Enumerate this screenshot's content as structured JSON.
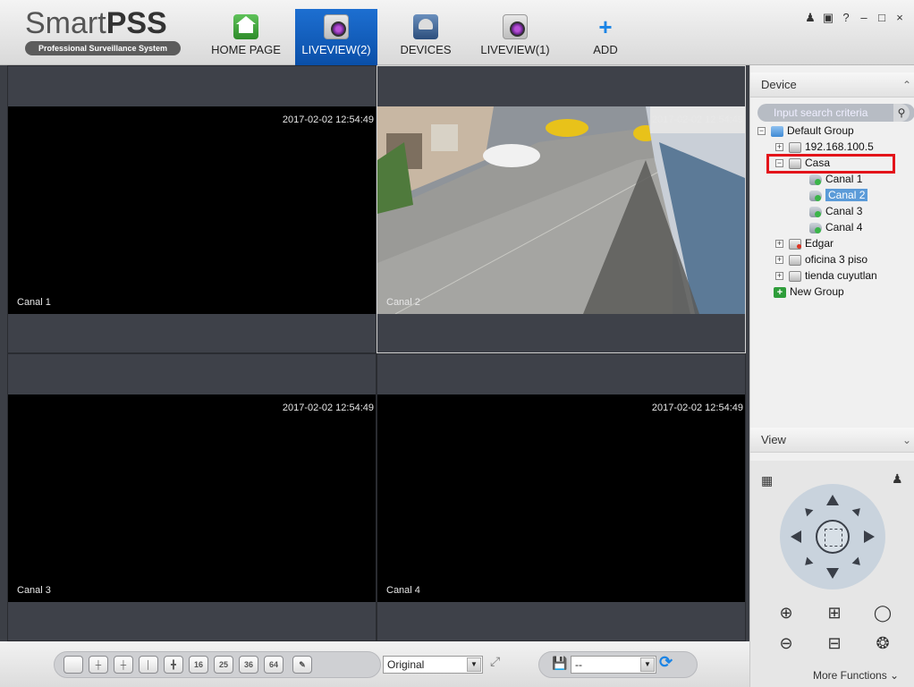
{
  "app": {
    "logo_name_plain": "Smart",
    "logo_name_bold": "PSS",
    "logo_tagline": "Professional Surveillance System"
  },
  "tabs": [
    {
      "label": "HOME PAGE",
      "icon": "home-icon",
      "active": false
    },
    {
      "label": "LIVEVIEW(2)",
      "icon": "camera-icon",
      "active": true
    },
    {
      "label": "DEVICES",
      "icon": "devices-icon",
      "active": false
    },
    {
      "label": "LIVEVIEW(1)",
      "icon": "camera-icon",
      "active": false
    },
    {
      "label": "ADD",
      "icon": "plus-icon",
      "active": false
    }
  ],
  "window_controls": [
    "user-icon",
    "lock-icon",
    "help-icon",
    "minimize-icon",
    "maximize-icon",
    "close-icon"
  ],
  "window_controls_text": {
    "help": "?",
    "minimize": "–",
    "maximize": "□",
    "close": "×"
  },
  "channels": [
    {
      "name": "Canal 1",
      "timestamp": "2017-02-02 12:54:49",
      "has_video": false
    },
    {
      "name": "Canal 2",
      "timestamp": "2017-02-02 12:54:49",
      "has_video": true,
      "selected": true
    },
    {
      "name": "Canal 3",
      "timestamp": "2017-02-02 12:54:49",
      "has_video": false
    },
    {
      "name": "Canal 4",
      "timestamp": "2017-02-02 12:54:49",
      "has_video": false
    }
  ],
  "toolbar": {
    "layouts": [
      "",
      "",
      "",
      "",
      "",
      "16",
      "25",
      "36",
      "64"
    ],
    "stream_select": "Original",
    "preset_select": "--"
  },
  "device_panel": {
    "title": "Device",
    "search_placeholder": "Input search criteria",
    "tree": [
      {
        "label": "Default Group",
        "level": 0,
        "icon": "folder-icon",
        "expander": "−"
      },
      {
        "label": "192.168.100.5",
        "level": 1,
        "icon": "device-icon",
        "expander": "+"
      },
      {
        "label": "Casa",
        "level": 1,
        "icon": "device-icon",
        "expander": "−",
        "highlighted": true
      },
      {
        "label": "Canal 1",
        "level": 2,
        "icon": "camera-icon"
      },
      {
        "label": "Canal 2",
        "level": 2,
        "icon": "camera-icon",
        "selected": true
      },
      {
        "label": "Canal 3",
        "level": 2,
        "icon": "camera-icon"
      },
      {
        "label": "Canal 4",
        "level": 2,
        "icon": "camera-icon"
      },
      {
        "label": "Edgar",
        "level": 1,
        "icon": "device-offline-icon",
        "expander": "+"
      },
      {
        "label": "oficina 3 piso",
        "level": 1,
        "icon": "device-icon",
        "expander": "+"
      },
      {
        "label": "tienda cuyutlan",
        "level": 1,
        "icon": "device-icon",
        "expander": "+"
      },
      {
        "label": "New Group",
        "level": 0,
        "icon": "add-group-icon"
      }
    ]
  },
  "view_panel": {
    "title": "View",
    "more_functions": "More Functions"
  },
  "colors": {
    "accent": "#0a5ac2",
    "highlight_box": "#e3141a",
    "selection": "#5b9bd8"
  }
}
